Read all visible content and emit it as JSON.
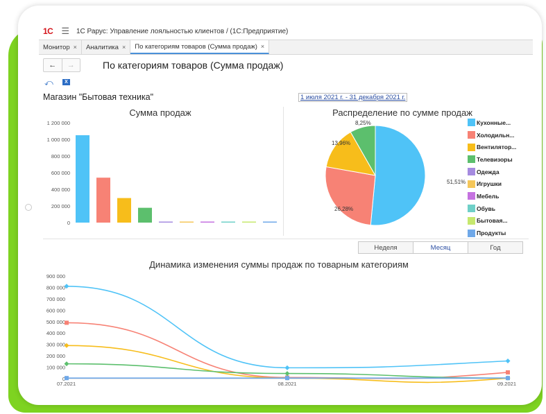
{
  "app": {
    "title": "1С Рарус: Управление лояльностью клиентов /  (1С:Предприятие)",
    "logo_text": "1С"
  },
  "tabs": [
    {
      "label": "Монитор",
      "close": "×"
    },
    {
      "label": "Аналитика",
      "close": "×"
    },
    {
      "label": "По категориям товаров (Сумма продаж)",
      "close": "×",
      "active": true
    }
  ],
  "nav": {
    "back": "←",
    "forward": "→"
  },
  "form": {
    "title": "По категориям товаров (Сумма продаж)",
    "store": "Магазин \"Бытовая техника\"",
    "period": "1 июля 2021 г. - 31 декабря 2021 г.",
    "excel_label": "X"
  },
  "period_buttons": [
    {
      "label": "Неделя"
    },
    {
      "label": "Месяц",
      "active": true
    },
    {
      "label": "Год"
    }
  ],
  "colors": {
    "kitchen": "#4fc3f7",
    "fridge": "#f78275",
    "fans": "#f7bd1b",
    "tv": "#5cbf6d",
    "clothes": "#a58be0",
    "toys": "#f5c75a",
    "furniture": "#c572e0",
    "shoes": "#6fd0c8",
    "household": "#c6e86e",
    "food": "#6fa8e8",
    "accent": "#2b4ea2",
    "brand_green": "#7ed321"
  },
  "chart_data": [
    {
      "type": "bar",
      "title": "Сумма продаж",
      "categories": [
        "Кухонные...",
        "Холодильн...",
        "Вентилятор...",
        "Телевизоры",
        "Одежда",
        "Игрушки",
        "Мебель",
        "Обувь",
        "Бытовая...",
        "Продукты"
      ],
      "values": [
        1050000,
        540000,
        295000,
        178000,
        6000,
        5000,
        6000,
        5000,
        4000,
        5000
      ],
      "ylim": [
        0,
        1200000
      ],
      "yticks": [
        "1 200 000",
        "1 000 000",
        "800 000",
        "600 000",
        "400 000",
        "200 000",
        "0"
      ],
      "grid": false
    },
    {
      "type": "pie",
      "title": "Распределение по сумме продаж",
      "slices": [
        {
          "name": "Кухонные...",
          "value": 51.51,
          "label": "51,51%"
        },
        {
          "name": "Холодильн...",
          "value": 26.28,
          "label": "26,28%"
        },
        {
          "name": "Вентилятор...",
          "value": 13.96,
          "label": "13,96%"
        },
        {
          "name": "Телевизоры",
          "value": 8.25,
          "label": "8,25%"
        }
      ],
      "legend": [
        "Кухонные...",
        "Холодильн...",
        "Вентилятор...",
        "Телевизоры",
        "Одежда",
        "Игрушки",
        "Мебель",
        "Обувь",
        "Бытовая...",
        "Продукты"
      ],
      "legend_position": "right"
    },
    {
      "type": "line",
      "title": "Динамика изменения суммы продаж по товарным категориям",
      "x": [
        "07.2021",
        "08.2021",
        "09.2021"
      ],
      "ylim": [
        0,
        900000
      ],
      "yticks": [
        "900 000",
        "800 000",
        "700 000",
        "600 000",
        "500 000",
        "400 000",
        "300 000",
        "200 000",
        "100 000",
        "0"
      ],
      "series": [
        {
          "values": [
            810000,
            95000,
            155000
          ]
        },
        {
          "values": [
            490000,
            10000,
            55000
          ]
        },
        {
          "values": [
            290000,
            5000,
            5000
          ]
        },
        {
          "values": [
            130000,
            45000,
            5000
          ]
        },
        {
          "values": [
            5000,
            5000,
            5000
          ]
        }
      ]
    }
  ]
}
